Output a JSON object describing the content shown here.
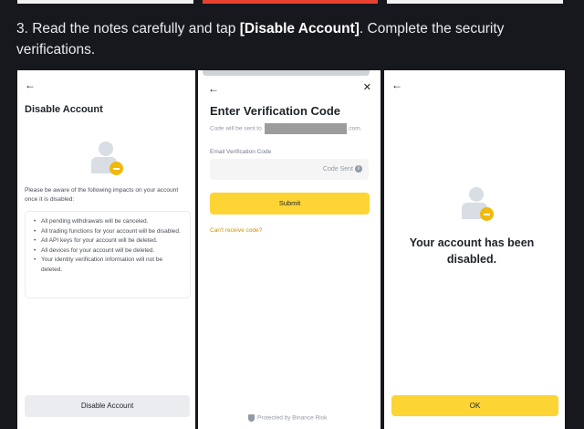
{
  "step": {
    "prefix": "3. Read the notes carefully and tap ",
    "highlight": "[Disable Account]",
    "suffix": ". Complete the security verifications."
  },
  "panel1": {
    "back_icon": "arrow-left-icon",
    "title": "Disable Account",
    "note": "Please be aware of the following impacts on your account once it is disabled:",
    "impacts": [
      "All pending withdrawals will be canceled.",
      "All trading functions for your account will be disabled.",
      "All API keys for your account will be deleted.",
      "All devices for your account will be deleted.",
      "Your identity verification information will not be deleted."
    ],
    "button_label": "Disable Account"
  },
  "panel2": {
    "title": "Enter Verification Code",
    "sent_prefix": "Code will be sent to",
    "sent_suffix": ".com.",
    "field_label": "Email Verification Code",
    "code_sent": "Code Sent",
    "submit_label": "Submit",
    "cant_receive": "Can't receive code?",
    "protected": "Protected by Binance Risk",
    "close_icon": "close-icon"
  },
  "panel3": {
    "message": "Your account has been disabled.",
    "ok_label": "OK"
  },
  "colors": {
    "accent": "#fcd535",
    "badge": "#f0b90b",
    "link": "#c99400",
    "background": "#17181e"
  }
}
